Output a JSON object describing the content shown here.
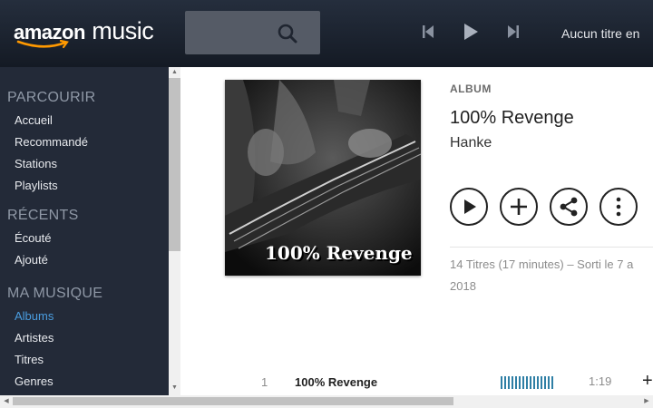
{
  "header": {
    "logo_brand": "amazon",
    "logo_product": "music",
    "now_playing": "Aucun titre en"
  },
  "sidebar": {
    "sections": [
      {
        "title": "PARCOURIR",
        "items": [
          "Accueil",
          "Recommandé",
          "Stations",
          "Playlists"
        ]
      },
      {
        "title": "RÉCENTS",
        "items": [
          "Écouté",
          "Ajouté"
        ]
      },
      {
        "title": "MA MUSIQUE",
        "items": [
          "Albums",
          "Artistes",
          "Titres",
          "Genres"
        ]
      }
    ],
    "active_item": "Albums"
  },
  "album": {
    "kind": "ALBUM",
    "title": "100% Revenge",
    "artist": "Hanke",
    "cover_text": "100% Revenge",
    "meta_line1": "14 Titres (17 minutes) – Sorti le 7 a",
    "meta_line2": "2018"
  },
  "tracks": [
    {
      "number": "1",
      "title": "100% Revenge",
      "duration": "1:19",
      "add": "+"
    }
  ],
  "icons": {
    "search": "search-icon",
    "prev": "skip-back-icon",
    "play": "play-icon",
    "next": "skip-forward-icon",
    "album_play": "play-icon",
    "album_add": "plus-icon",
    "album_share": "share-icon",
    "album_more": "more-icon"
  },
  "colors": {
    "header_bg": "#1b2230",
    "sidebar_bg": "#232a38",
    "active_nav": "#4a9de0",
    "eq_bars": "#2f7fa5"
  }
}
